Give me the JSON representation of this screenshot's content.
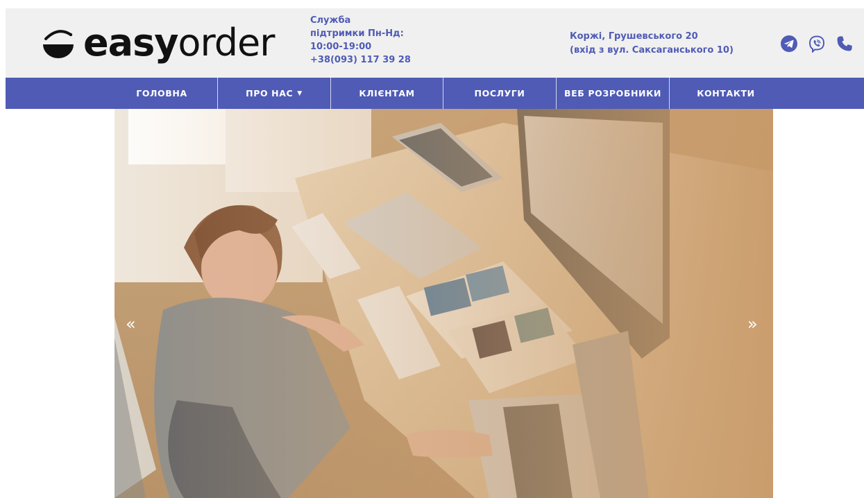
{
  "brand": {
    "logo_bold": "easy",
    "logo_light": "order"
  },
  "support": {
    "line1": "Служба",
    "line2": "підтримки Пн-Нд:",
    "hours": "10:00-19:00",
    "phone": "+38(093) 117 39 28"
  },
  "address": {
    "line1": "Коржі, Грушевського 20",
    "line2": "(вхід з вул. Саксаганського 10)"
  },
  "social": {
    "icons": [
      "telegram-icon",
      "viber-icon",
      "phone-icon"
    ]
  },
  "nav": {
    "items": [
      {
        "label": "ГОЛОВНА"
      },
      {
        "label": "ПРО НАС"
      },
      {
        "label": "КЛІЄНТАМ"
      },
      {
        "label": "ПОСЛУГИ"
      },
      {
        "label": "ВЕБ РОЗРОБНИКИ"
      },
      {
        "label": "КОНТАКТИ"
      }
    ]
  },
  "slider": {
    "prev_label": "«",
    "next_label": "»"
  },
  "colors": {
    "accent": "#4f5bb5",
    "header_bg": "#f0f0f0",
    "nav_text": "#ffffff"
  }
}
